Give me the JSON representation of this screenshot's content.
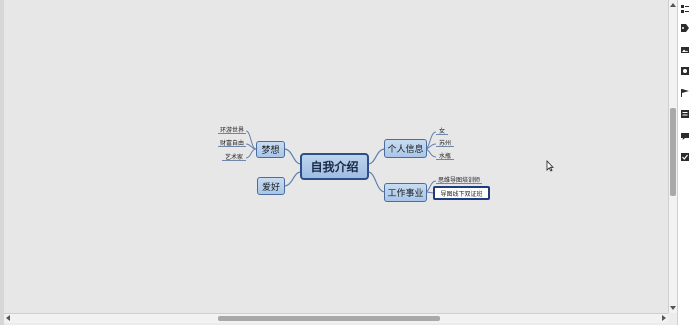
{
  "mindmap": {
    "central": "自我介绍",
    "right_topics": [
      {
        "label": "个人信息",
        "children": [
          "女",
          "苏州",
          "水瓶"
        ]
      },
      {
        "label": "工作事业",
        "children": [
          "思维导图培训师",
          "导图线下双证班"
        ]
      }
    ],
    "left_topics": [
      {
        "label": "梦想",
        "children": [
          "环游世界",
          "财富自由",
          "艺术家"
        ]
      },
      {
        "label": "爱好",
        "children": []
      }
    ],
    "selected_topic": "导图线下双证班"
  },
  "toolbar": {
    "icons": [
      "outline-icon",
      "tag-icon",
      "image-icon",
      "sticker-icon",
      "flag-icon",
      "note-icon",
      "comment-icon",
      "task-icon",
      "link-icon",
      "checkbox-icon"
    ]
  },
  "colors": {
    "canvas": "#e8e7e7",
    "topic_fill": "#a9c6e8",
    "topic_border": "#2b4f86",
    "connector": "#5f7fad"
  }
}
